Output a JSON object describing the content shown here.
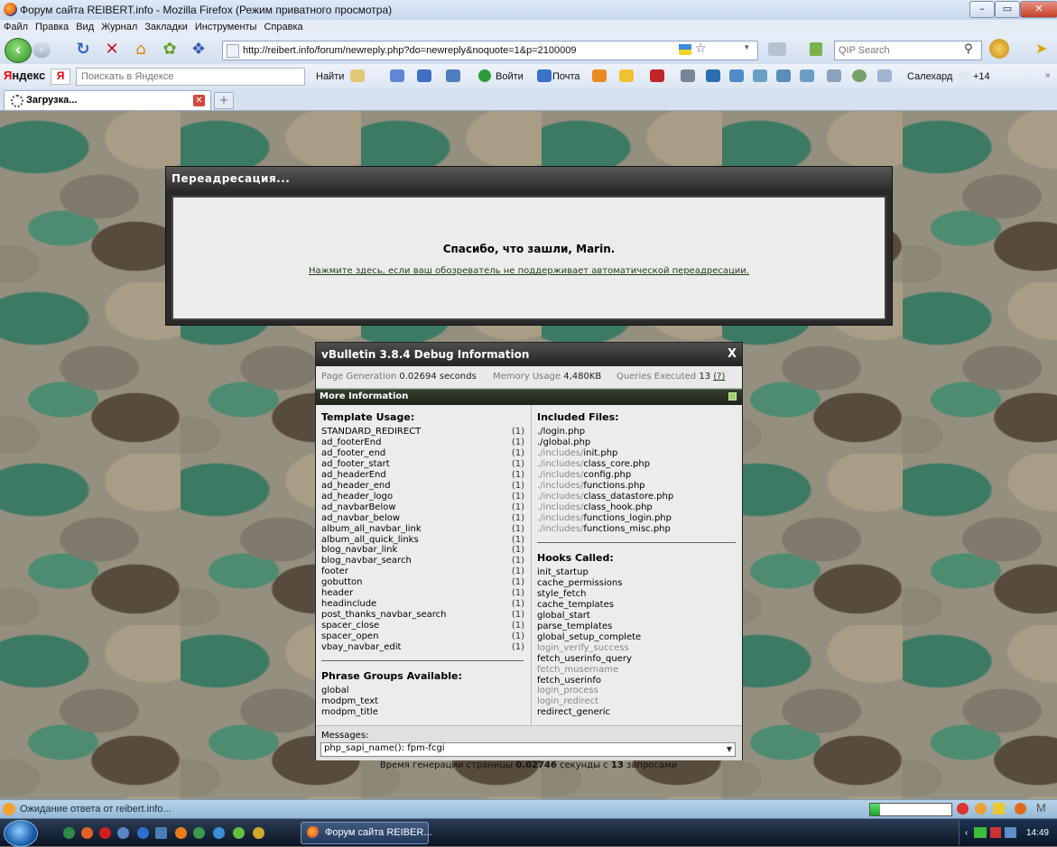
{
  "window": {
    "title": "Форум сайта REIBERT.info - Mozilla Firefox (Режим приватного просмотра)"
  },
  "menu": [
    "Файл",
    "Правка",
    "Вид",
    "Журнал",
    "Закладки",
    "Инструменты",
    "Справка"
  ],
  "navbar": {
    "url": "http://reibert.info/forum/newreply.php?do=newreply&noquote=1&p=2100009",
    "search_placeholder": "QIP Search"
  },
  "yandex": {
    "logo_left": "Я",
    "logo_right": "ндекс",
    "search_placeholder": "Поискать в Яндексе",
    "find_label": "Найти",
    "login_label": "Войти",
    "mail_label": "Почта",
    "city": "Салехард",
    "weather": "+14"
  },
  "tab": {
    "title": "Загрузка...",
    "close": "✕",
    "new": "+"
  },
  "redirect": {
    "title": "Переадресация...",
    "thanks": "Спасибо, что зашли, Marin.",
    "link": "Нажмите здесь, если ваш обозреватель не поддерживает автоматической переадресации."
  },
  "debug": {
    "title": "vBulletin 3.8.4 Debug Information",
    "close": "X",
    "page_gen_label": "Page Generation",
    "page_gen_value": "0.02694 seconds",
    "memory_label": "Memory Usage",
    "memory_value": "4,480KB",
    "queries_label": "Queries Executed",
    "queries_value": "13",
    "queries_link": "(?)",
    "more_info": "More Information",
    "template_usage_title": "Template Usage:",
    "templates": [
      {
        "name": "STANDARD_REDIRECT",
        "count": "(1)"
      },
      {
        "name": "ad_footerEnd",
        "count": "(1)"
      },
      {
        "name": "ad_footer_end",
        "count": "(1)"
      },
      {
        "name": "ad_footer_start",
        "count": "(1)"
      },
      {
        "name": "ad_headerEnd",
        "count": "(1)"
      },
      {
        "name": "ad_header_end",
        "count": "(1)"
      },
      {
        "name": "ad_header_logo",
        "count": "(1)"
      },
      {
        "name": "ad_navbarBelow",
        "count": "(1)"
      },
      {
        "name": "ad_navbar_below",
        "count": "(1)"
      },
      {
        "name": "album_all_navbar_link",
        "count": "(1)"
      },
      {
        "name": "album_all_quick_links",
        "count": "(1)"
      },
      {
        "name": "blog_navbar_link",
        "count": "(1)"
      },
      {
        "name": "blog_navbar_search",
        "count": "(1)"
      },
      {
        "name": "footer",
        "count": "(1)"
      },
      {
        "name": "gobutton",
        "count": "(1)"
      },
      {
        "name": "header",
        "count": "(1)"
      },
      {
        "name": "headinclude",
        "count": "(1)"
      },
      {
        "name": "post_thanks_navbar_search",
        "count": "(1)"
      },
      {
        "name": "spacer_close",
        "count": "(1)"
      },
      {
        "name": "spacer_open",
        "count": "(1)"
      },
      {
        "name": "vbay_navbar_edit",
        "count": "(1)"
      }
    ],
    "phrase_groups_title": "Phrase Groups Available:",
    "phrase_groups": [
      "global",
      "modpm_text",
      "modpm_title"
    ],
    "included_files_title": "Included Files:",
    "included_files": [
      {
        "dir": "./",
        "file": "login.php"
      },
      {
        "dir": "./",
        "file": "global.php"
      },
      {
        "dir": "./includes/",
        "file": "init.php"
      },
      {
        "dir": "./includes/",
        "file": "class_core.php"
      },
      {
        "dir": "./includes/",
        "file": "config.php"
      },
      {
        "dir": "./includes/",
        "file": "functions.php"
      },
      {
        "dir": "./includes/",
        "file": "class_datastore.php"
      },
      {
        "dir": "./includes/",
        "file": "class_hook.php"
      },
      {
        "dir": "./includes/",
        "file": "functions_login.php"
      },
      {
        "dir": "./includes/",
        "file": "functions_misc.php"
      }
    ],
    "hooks_title": "Hooks Called:",
    "hooks": [
      {
        "name": "init_startup",
        "dim": false
      },
      {
        "name": "cache_permissions",
        "dim": false
      },
      {
        "name": "style_fetch",
        "dim": false
      },
      {
        "name": "cache_templates",
        "dim": false
      },
      {
        "name": "global_start",
        "dim": false
      },
      {
        "name": "parse_templates",
        "dim": false
      },
      {
        "name": "global_setup_complete",
        "dim": false
      },
      {
        "name": "login_verify_success",
        "dim": true
      },
      {
        "name": "fetch_userinfo_query",
        "dim": false
      },
      {
        "name": "fetch_musername",
        "dim": true
      },
      {
        "name": "fetch_userinfo",
        "dim": false
      },
      {
        "name": "login_process",
        "dim": true
      },
      {
        "name": "login_redirect",
        "dim": true
      },
      {
        "name": "redirect_generic",
        "dim": false
      }
    ],
    "messages_label": "Messages:",
    "messages_value": "php_sapi_name(): fpm-fcgi"
  },
  "footer": {
    "prefix": "Время генерации страницы",
    "time": "0.02746",
    "middle": "секунды с",
    "queries": "13",
    "suffix": "запросами"
  },
  "status": {
    "text": "Ожидание ответа от reibert.info...",
    "progress": 0.12
  },
  "taskbar": {
    "task_title": "Форум сайта REIBER...",
    "clock": "14:49"
  },
  "colors": {
    "link_green": "#22401a",
    "more_bar": "#1d2419",
    "dim_text": "#888888"
  }
}
